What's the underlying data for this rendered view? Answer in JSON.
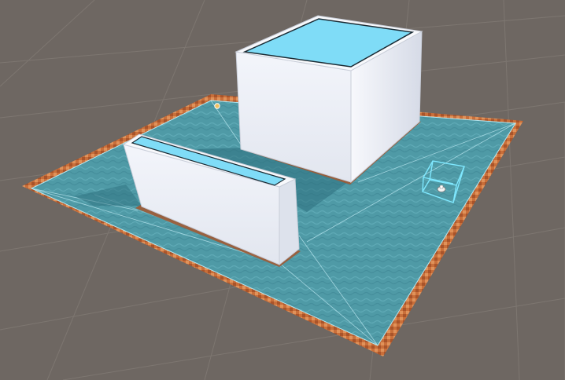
{
  "app": {
    "view": "Scene view",
    "projection": "perspective"
  },
  "scene": {
    "grid": true,
    "colors": {
      "background": "#6e6762",
      "grid_line": "#8a837d",
      "navmesh_fill": "#4f9aa6",
      "navmesh_border": "#c96f3a",
      "navmesh_edge": "#b4e6f0",
      "box_side_light": "#f3f5fb",
      "box_side_shade": "#d2d7e4",
      "box_top_highlight": "#7fdcf7",
      "selection_wireframe": "#7fe8ff",
      "light_gizmo": "#f0c060"
    },
    "objects": [
      {
        "name": "cube-obstacle",
        "kind": "box",
        "selected": false
      },
      {
        "name": "wall-obstacle",
        "kind": "box",
        "selected": false
      },
      {
        "name": "navmesh-surface",
        "kind": "navmesh",
        "baked": true
      },
      {
        "name": "agent-bounds",
        "kind": "wire-box",
        "selected": true
      },
      {
        "name": "light-gizmo",
        "kind": "gizmo-icon",
        "selected": false
      }
    ]
  }
}
